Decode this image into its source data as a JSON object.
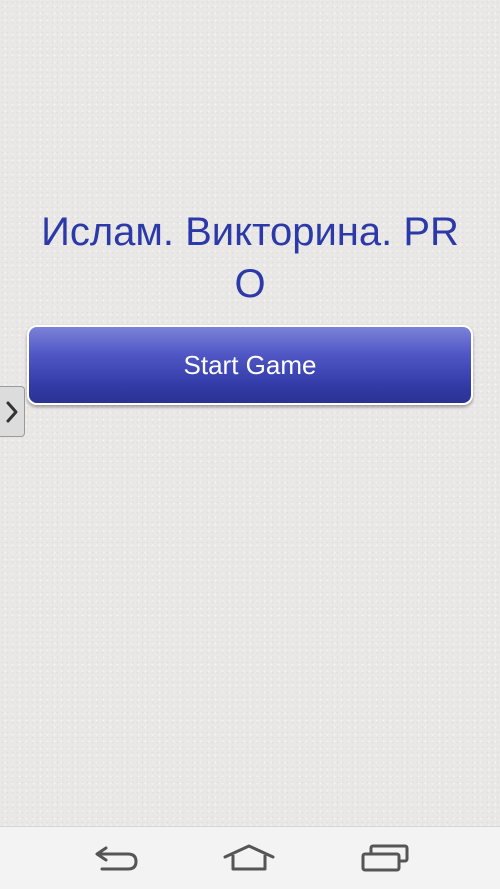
{
  "app": {
    "title": "Ислам. Викторина. PRO",
    "start_button_label": "Start Game"
  },
  "icons": {
    "drawer_handle": "chevron-right-icon",
    "back": "back-icon",
    "home": "home-icon",
    "recent_apps": "recent-apps-icon"
  },
  "colors": {
    "title": "#2b3aa8",
    "button_top": "#7b82d8",
    "button_bottom": "#2a3292",
    "button_text": "#ffffff",
    "background": "#e9e8e6",
    "navbar": "#f3f3f3"
  }
}
